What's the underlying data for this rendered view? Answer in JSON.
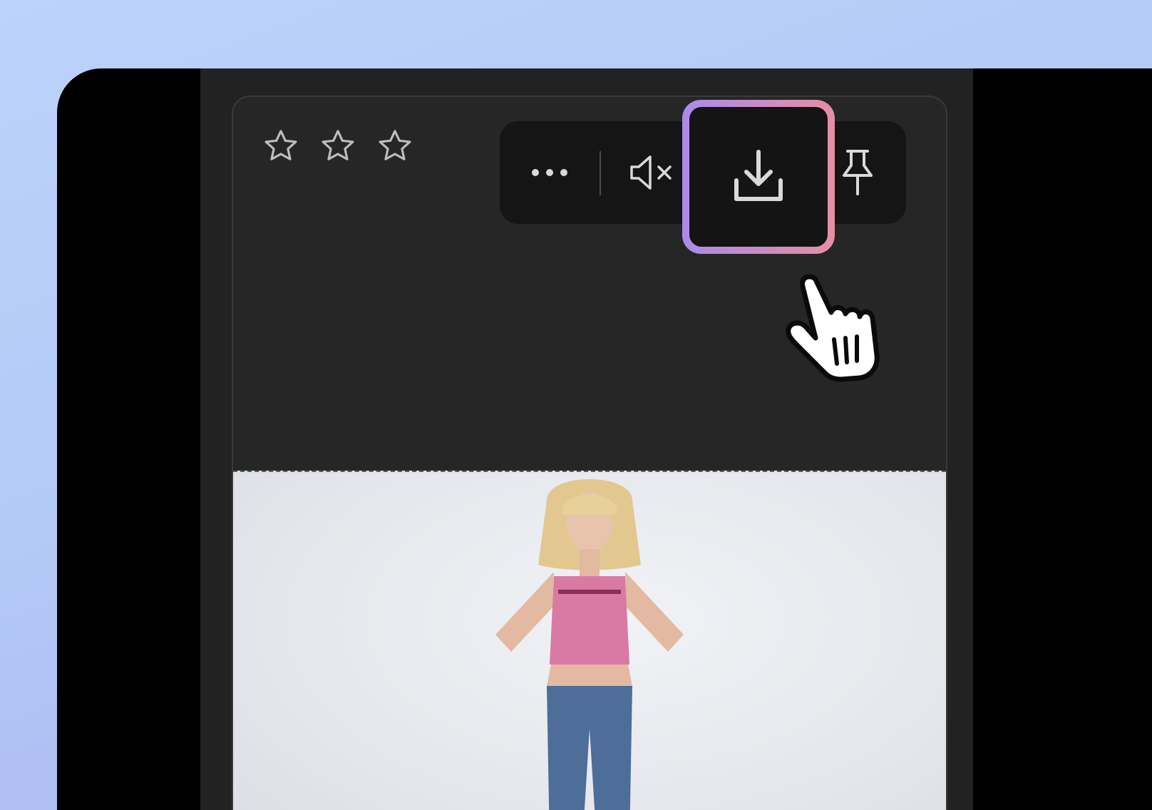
{
  "rating": {
    "stars_total": 3,
    "stars_filled": 0
  },
  "toolbar": {
    "buttons": [
      {
        "name": "more-options",
        "icon": "more-horizontal-icon"
      },
      {
        "name": "mute",
        "icon": "volume-mute-icon"
      },
      {
        "name": "download",
        "icon": "download-icon",
        "highlighted": true
      },
      {
        "name": "pin",
        "icon": "pin-icon"
      }
    ],
    "highlight_gradient": [
      "#a98bea",
      "#e78ea3"
    ]
  },
  "media": {
    "type": "photo",
    "description_visible": false
  },
  "cursor": {
    "icon": "hand-pointer-icon"
  },
  "colors": {
    "background": "#bcd3fb",
    "device": "#000000",
    "card": "#262626",
    "toolbar": "#151515",
    "icon": "#d9d9d9"
  }
}
